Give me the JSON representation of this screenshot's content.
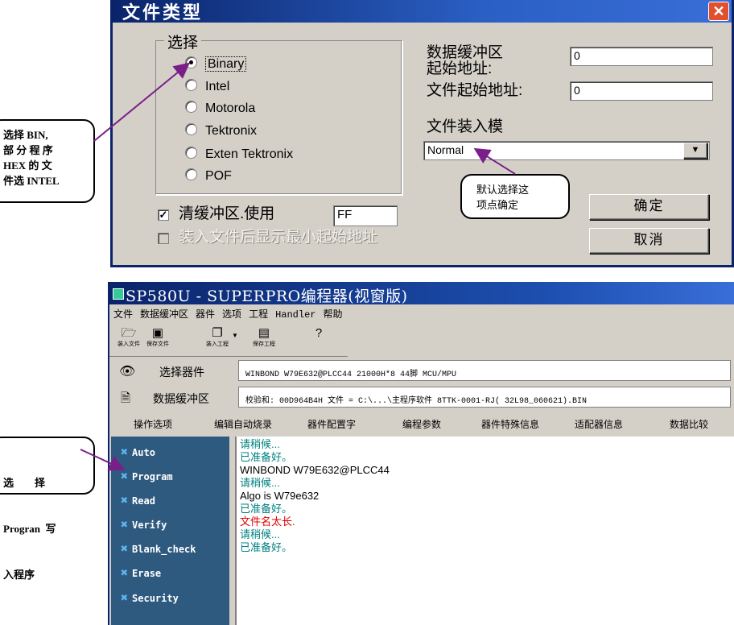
{
  "dialog": {
    "title": "文件类型",
    "group_label": "选择",
    "formats": [
      "Binary",
      "Intel",
      "Motorola",
      "Tektronix",
      "Exten Tektronix",
      "POF"
    ],
    "selected_format": "Binary",
    "buffer_start_label_1": "数据缓冲区",
    "buffer_start_label_2": "起始地址:",
    "buffer_start_value": "0",
    "file_start_label": "文件起始地址:",
    "file_start_value": "0",
    "load_mode_label": "文件装入模",
    "load_mode_value": "Normal",
    "clear_buffer_label": "清缓冲区.使用",
    "clear_buffer_checked": true,
    "clear_buffer_value": "FF",
    "show_min_addr_label": "装入文件后显示最小起始地址",
    "ok_label": "确定",
    "cancel_label": "取消"
  },
  "callouts": {
    "bin": [
      "选择 BIN,",
      "部 分 程 序",
      "HEX  的 文",
      "件选 INTEL"
    ],
    "default": [
      "默认选择这",
      "项点确定"
    ],
    "program": [
      "选        择",
      "Progran  写",
      "入程序"
    ]
  },
  "app": {
    "title": "SP580U - SUPERPRO编程器(视窗版)",
    "menu": [
      "文件",
      "数据缓冲区",
      "器件",
      "选项",
      "工程",
      "Handler",
      "帮助"
    ],
    "toolbar": [
      "装入文件",
      "保存文件",
      "装入工程",
      "保存工程"
    ],
    "select_device_label": "选择器件",
    "device_info": "WINBOND  W79E632@PLCC44  21000H*8  44脚  MCU/MPU",
    "buffer_label": "数据缓冲区",
    "buffer_info": "校验和: 00D964B4H     文件 = C:\\...\\主程序软件 8TTK-0001-RJ( 32L98_060621).BIN",
    "tabs": [
      "操作选项",
      "编辑自动烧录",
      "器件配置字",
      "编程参数",
      "器件特殊信息",
      "适配器信息",
      "数据比较"
    ],
    "actions": [
      "Auto",
      "Program",
      "Read",
      "Verify",
      "Blank_check",
      "Erase",
      "Security"
    ],
    "log": [
      {
        "text": "请稍候...",
        "color": "teal"
      },
      {
        "text": "已准备好。",
        "color": "teal"
      },
      {
        "text": "WINBOND W79E632@PLCC44",
        "color": "black"
      },
      {
        "text": "请稍候...",
        "color": "teal"
      },
      {
        "text": "Algo is W79e632",
        "color": "black"
      },
      {
        "text": "已准备好。",
        "color": "teal"
      },
      {
        "text": "文件名太长.",
        "color": "red"
      },
      {
        "text": "请稍候...",
        "color": "teal"
      },
      {
        "text": "已准备好。",
        "color": "teal"
      }
    ]
  },
  "colors": {
    "titlebar": "#0a246a",
    "side_panel": "#2e5a80",
    "arrow": "#7a1f8a",
    "log_teal": "#008080",
    "log_red": "#e00000"
  }
}
